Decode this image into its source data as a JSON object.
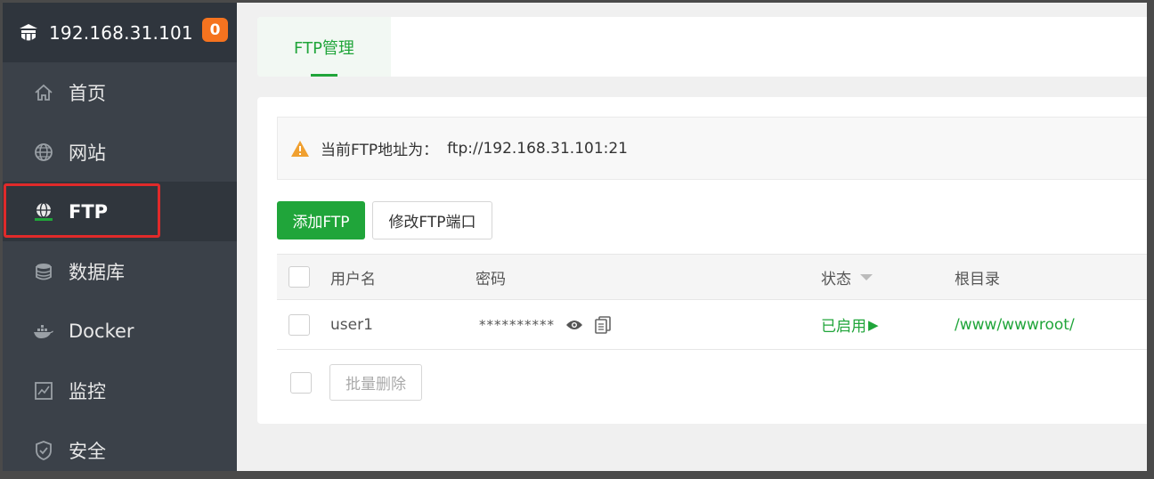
{
  "sidebar": {
    "server_ip": "192.168.31.101",
    "badge_count": "0",
    "items": [
      {
        "label": "首页",
        "icon": "home-icon"
      },
      {
        "label": "网站",
        "icon": "globe-icon"
      },
      {
        "label": "FTP",
        "icon": "ftp-icon",
        "active": true
      },
      {
        "label": "数据库",
        "icon": "database-icon"
      },
      {
        "label": "Docker",
        "icon": "docker-icon"
      },
      {
        "label": "监控",
        "icon": "monitor-icon"
      },
      {
        "label": "安全",
        "icon": "shield-icon"
      }
    ]
  },
  "tabs": [
    {
      "label": "FTP管理",
      "active": true
    }
  ],
  "notice": {
    "label": "当前FTP地址为：",
    "address": "ftp://192.168.31.101:21"
  },
  "toolbar": {
    "add_label": "添加FTP",
    "port_label": "修改FTP端口"
  },
  "table": {
    "headers": {
      "user": "用户名",
      "password": "密码",
      "status": "状态",
      "root": "根目录"
    },
    "rows": [
      {
        "user": "user1",
        "password": "**********",
        "status": "已启用",
        "status_symbol": "▶",
        "root": "/www/wwwroot/"
      }
    ]
  },
  "batch": {
    "delete_label": "批量删除"
  },
  "colors": {
    "accent": "#20a53a",
    "badge": "#f5731f",
    "sidebar_bg": "#3b4149",
    "highlight": "#e02a2a"
  }
}
